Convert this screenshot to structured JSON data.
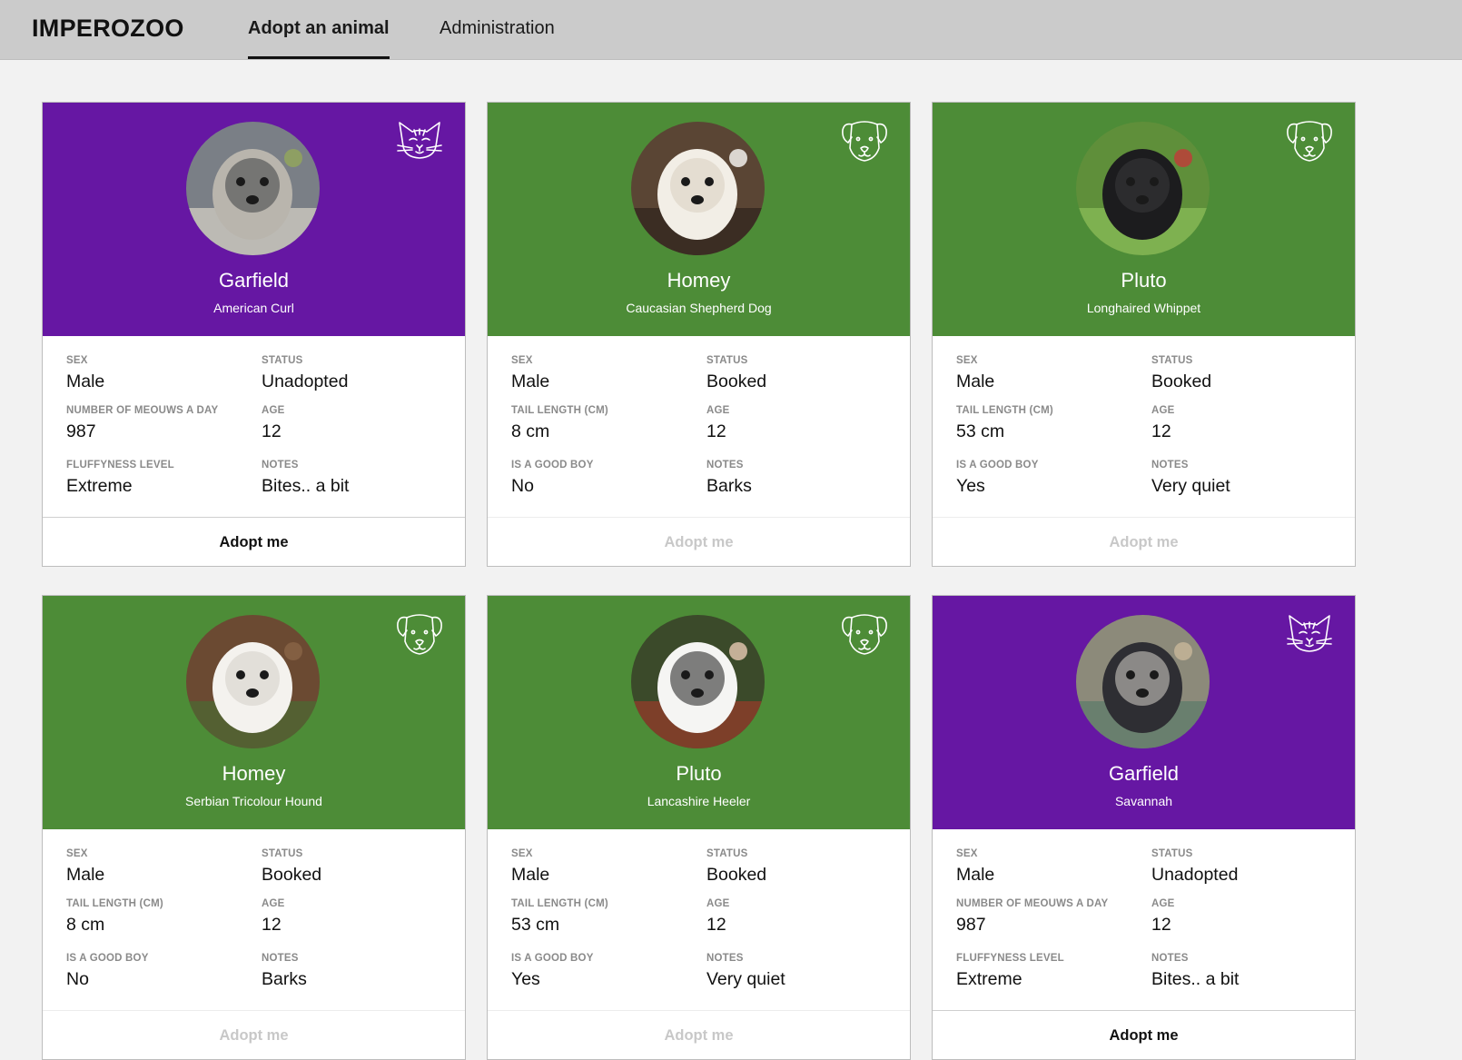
{
  "header": {
    "logo": "IMPEROZOO",
    "tabs": [
      {
        "label": "Adopt an animal",
        "active": true
      },
      {
        "label": "Administration",
        "active": false
      }
    ]
  },
  "colors": {
    "cat": "#6617a3",
    "dog": "#4d8c37"
  },
  "cards": [
    {
      "species": "cat",
      "species_icon": "cat-icon",
      "name": "Garfield",
      "breed": "American Curl",
      "fields": [
        {
          "label": "SEX",
          "value": "Male"
        },
        {
          "label": "STATUS",
          "value": "Unadopted"
        },
        {
          "label": "NUMBER OF MEOUWS A DAY",
          "value": "987"
        },
        {
          "label": "AGE",
          "value": "12"
        },
        {
          "label": "FLUFFYNESS LEVEL",
          "value": "Extreme"
        },
        {
          "label": "NOTES",
          "value": "Bites.. a bit"
        }
      ],
      "adopt_label": "Adopt me",
      "adopt_enabled": true
    },
    {
      "species": "dog",
      "species_icon": "dog-icon",
      "name": "Homey",
      "breed": "Caucasian Shepherd Dog",
      "fields": [
        {
          "label": "SEX",
          "value": "Male"
        },
        {
          "label": "STATUS",
          "value": "Booked"
        },
        {
          "label": "TAIL LENGTH (Cm)",
          "value": "8 cm"
        },
        {
          "label": "AGE",
          "value": "12"
        },
        {
          "label": "IS A GOOD BOY",
          "value": "No"
        },
        {
          "label": "NOTES",
          "value": "Barks"
        }
      ],
      "adopt_label": "Adopt me",
      "adopt_enabled": false
    },
    {
      "species": "dog",
      "species_icon": "dog-icon",
      "name": "Pluto",
      "breed": "Longhaired Whippet",
      "fields": [
        {
          "label": "SEX",
          "value": "Male"
        },
        {
          "label": "STATUS",
          "value": "Booked"
        },
        {
          "label": "TAIL LENGTH (Cm)",
          "value": "53 cm"
        },
        {
          "label": "AGE",
          "value": "12"
        },
        {
          "label": "IS A GOOD BOY",
          "value": "Yes"
        },
        {
          "label": "NOTES",
          "value": "Very quiet"
        }
      ],
      "adopt_label": "Adopt me",
      "adopt_enabled": false
    },
    {
      "species": "dog",
      "species_icon": "dog-icon",
      "name": "Homey",
      "breed": "Serbian Tricolour Hound",
      "fields": [
        {
          "label": "SEX",
          "value": "Male"
        },
        {
          "label": "STATUS",
          "value": "Booked"
        },
        {
          "label": "TAIL LENGTH (Cm)",
          "value": "8 cm"
        },
        {
          "label": "AGE",
          "value": "12"
        },
        {
          "label": "IS A GOOD BOY",
          "value": "No"
        },
        {
          "label": "NOTES",
          "value": "Barks"
        }
      ],
      "adopt_label": "Adopt me",
      "adopt_enabled": false
    },
    {
      "species": "dog",
      "species_icon": "dog-icon",
      "name": "Pluto",
      "breed": "Lancashire Heeler",
      "fields": [
        {
          "label": "SEX",
          "value": "Male"
        },
        {
          "label": "STATUS",
          "value": "Booked"
        },
        {
          "label": "TAIL LENGTH (Cm)",
          "value": "53 cm"
        },
        {
          "label": "AGE",
          "value": "12"
        },
        {
          "label": "IS A GOOD BOY",
          "value": "Yes"
        },
        {
          "label": "NOTES",
          "value": "Very quiet"
        }
      ],
      "adopt_label": "Adopt me",
      "adopt_enabled": false
    },
    {
      "species": "cat",
      "species_icon": "cat-icon",
      "name": "Garfield",
      "breed": "Savannah",
      "fields": [
        {
          "label": "SEX",
          "value": "Male"
        },
        {
          "label": "STATUS",
          "value": "Unadopted"
        },
        {
          "label": "NUMBER OF MEOUWS A DAY",
          "value": "987"
        },
        {
          "label": "AGE",
          "value": "12"
        },
        {
          "label": "FLUFFYNESS LEVEL",
          "value": "Extreme"
        },
        {
          "label": "NOTES",
          "value": "Bites.. a bit"
        }
      ],
      "adopt_label": "Adopt me",
      "adopt_enabled": true
    }
  ]
}
